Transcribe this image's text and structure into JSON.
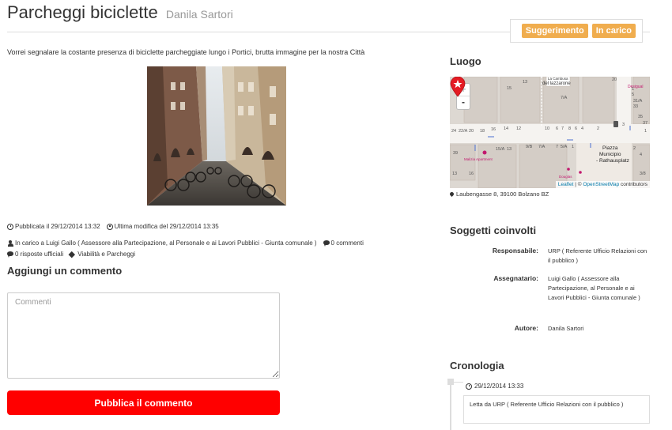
{
  "header": {
    "title": "Parcheggi biciclette",
    "author": "Danila Sartori",
    "badges": [
      "Suggerimento",
      "In carico"
    ]
  },
  "description": "Vorrei segnalare la costante presenza di biciclette parcheggiate lungo i Portici, brutta immagine per la nostra Città",
  "meta": {
    "published": "Pubblicata il 29/12/2014 13:32",
    "modified": "Ultima modifica del 29/12/2014 13:35",
    "assigned": "In carico a Luigi Gallo ( Assessore alla Partecipazione, al Personale e ai Lavori Pubblici - Giunta comunale )",
    "comments": "0 commenti",
    "official": "0 risposte ufficiali",
    "category": "Viabilità e Parcheggi"
  },
  "comment_form": {
    "heading": "Aggiungi un commento",
    "placeholder": "Commenti",
    "submit_label": "Pubblica il commento"
  },
  "location": {
    "heading": "Luogo",
    "address": "Laubengasse 8, 39100 Bolzano BZ",
    "map": {
      "zoom_in": "+",
      "zoom_out": "-",
      "attribution_leaflet": "Leaflet",
      "attribution_sep": " | © ",
      "attribution_osm": "OpenStreetMap",
      "attribution_suffix": " contributors",
      "labels": {
        "street": "del lazzarone",
        "street_top": "La Cambusa",
        "square": "Piazza",
        "square2": "Municipio",
        "square3": "- Rathausplatz",
        "shop": "Desigual",
        "shop2": "Malizia Apartment",
        "pink": "Douglas",
        "house_numbers": [
          "13",
          "15",
          "20",
          "7/A",
          "1",
          "5",
          "6",
          "7",
          "24",
          "22/A",
          "20",
          "18",
          "16",
          "14",
          "12",
          "10",
          "8",
          "6",
          "4",
          "2",
          "15/A",
          "13",
          "9/B",
          "7/A",
          "7",
          "5/A",
          "1",
          "31/A",
          "33",
          "35",
          "37",
          "3",
          "1",
          "2",
          "4",
          "3/8",
          "16",
          "13",
          "39"
        ]
      }
    }
  },
  "subjects": {
    "heading": "Soggetti coinvolti",
    "rows": [
      {
        "label": "Responsabile:",
        "value": "URP ( Referente Ufficio Relazioni con il pubblico )"
      },
      {
        "label": "Assegnatario:",
        "value": "Luigi Gallo ( Assessore alla Partecipazione, al Personale e ai Lavori Pubblici - Giunta comunale )"
      },
      {
        "label": "Autore:",
        "value": "Danila Sartori"
      }
    ]
  },
  "timeline": {
    "heading": "Cronologia",
    "entries": [
      {
        "date": "29/12/2014 13:33",
        "text": "Letta da URP ( Referente Ufficio Relazioni con il pubblico )"
      }
    ]
  },
  "colors": {
    "badge": "#f0ad4e",
    "submit": "#ff0000",
    "map_pin": "#e41b23"
  }
}
